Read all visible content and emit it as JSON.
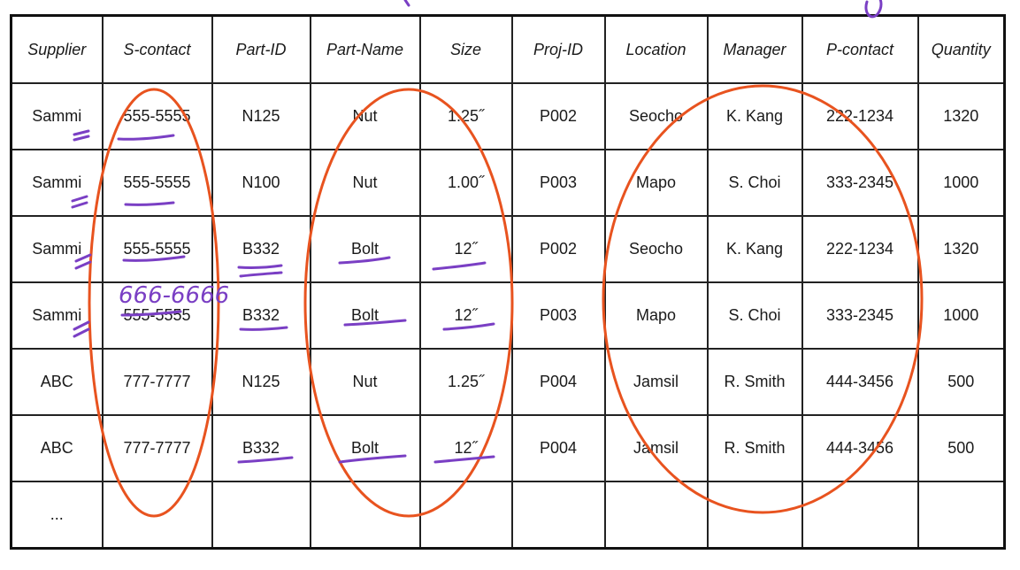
{
  "table": {
    "headers": [
      "Supplier",
      "S-contact",
      "Part-ID",
      "Part-Name",
      "Size",
      "Proj-ID",
      "Location",
      "Manager",
      "P-contact",
      "Quantity"
    ],
    "rows": [
      [
        "Sammi",
        "555-5555",
        "N125",
        "Nut",
        "1.25˝",
        "P002",
        "Seocho",
        "K. Kang",
        "222-1234",
        "1320"
      ],
      [
        "Sammi",
        "555-5555",
        "N100",
        "Nut",
        "1.00˝",
        "P003",
        "Mapo",
        "S. Choi",
        "333-2345",
        "1000"
      ],
      [
        "Sammi",
        "555-5555",
        "B332",
        "Bolt",
        "12˝",
        "P002",
        "Seocho",
        "K. Kang",
        "222-1234",
        "1320"
      ],
      [
        "Sammi",
        "555-5555",
        "B332",
        "Bolt",
        "12˝",
        "P003",
        "Mapo",
        "S. Choi",
        "333-2345",
        "1000"
      ],
      [
        "ABC",
        "777-7777",
        "N125",
        "Nut",
        "1.25˝",
        "P004",
        "Jamsil",
        "R. Smith",
        "444-3456",
        "500"
      ],
      [
        "ABC",
        "777-7777",
        "B332",
        "Bolt",
        "12˝",
        "P004",
        "Jamsil",
        "R. Smith",
        "444-3456",
        "500"
      ]
    ],
    "ellipsis": "..."
  },
  "annotations": {
    "handwritten_correction": "666-6666",
    "circle_color": "#e8531f",
    "pen_color": "#7a3fc4"
  }
}
